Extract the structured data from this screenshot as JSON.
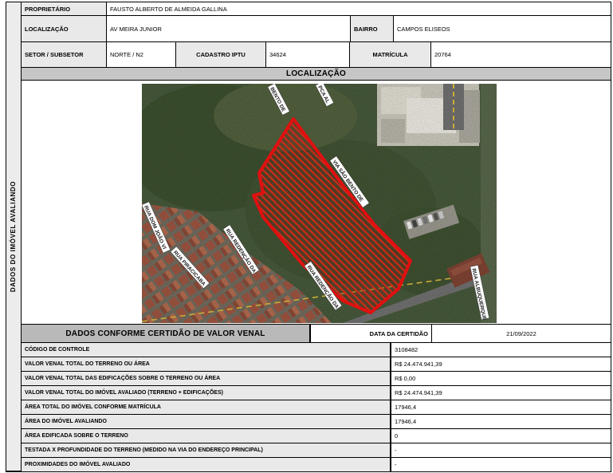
{
  "sidebar": {
    "label": "DADOS DO IMÓVEL AVALIANDO"
  },
  "property_info": {
    "proprietario_label": "PROPRIETÁRIO",
    "proprietario_value": "FAUSTO ALBERTO DE ALMEIDA GALLINA",
    "localizacao_label": "LOCALIZAÇÃO",
    "localizacao_value": "AV MEIRA JUNIOR",
    "bairro_label": "BAIRRO",
    "bairro_value": "CAMPOS ELISEOS",
    "setor_label": "SETOR / SUBSETOR",
    "setor_value": "NORTE / N2",
    "cadastro_label": "CADASTRO IPTU",
    "cadastro_value": "34624",
    "matricula_label": "MATRÍCULA",
    "matricula_value": "20764"
  },
  "map_section": {
    "title": "LOCALIZAÇÃO",
    "parcel_outline_color": "#e01010",
    "street_labels": [
      "BENTO DE",
      "PCA AL",
      "VIA SÃO BENTO DE",
      "RUA DOM JOÃO VI",
      "RUA REDENÇÃO DA",
      "RUA PIRACICABA",
      "RUA REDENÇÃO DA",
      "RUA ALBUQUERQUE"
    ]
  },
  "venal_section": {
    "title": "DADOS CONFORME CERTIDÃO DE VALOR VENAL",
    "data_certidao_label": "DATA DA CERTIDÃO",
    "data_certidao_value": "21/09/2022",
    "rows": [
      {
        "label": "CÓDIGO DE CONTROLE",
        "value": "3108482"
      },
      {
        "label": "VALOR VENAL TOTAL DO TERRENO OU ÁREA",
        "value": "R$ 24.474.941,39"
      },
      {
        "label": "VALOR VENAL TOTAL DAS EDIFICAÇÕES SOBRE O TERRENO OU ÁREA",
        "value": "R$ 0,00"
      },
      {
        "label": "VALOR VENAL TOTAL DO IMÓVEL AVALIADO (TERRENO + EDIFICAÇÕES)",
        "value": "R$ 24.474.941,39"
      },
      {
        "label": "ÁREA TOTAL DO IMÓVEL CONFORME MATRÍCULA",
        "value": "17946,4"
      },
      {
        "label": "ÁREA DO IMÓVEL AVALIANDO",
        "value": "17946,4"
      },
      {
        "label": "ÁREA EDIFICADA SOBRE O TERRENO",
        "value": "0"
      },
      {
        "label": "TESTADA X PROFUNDIDADE DO TERRENO (MEDIDO NA VIA DO ENDEREÇO PRINCIPAL)",
        "value": "-"
      },
      {
        "label": "PROXIMIDADES DO IMÓVEL AVALIADO",
        "value": "-"
      }
    ]
  }
}
